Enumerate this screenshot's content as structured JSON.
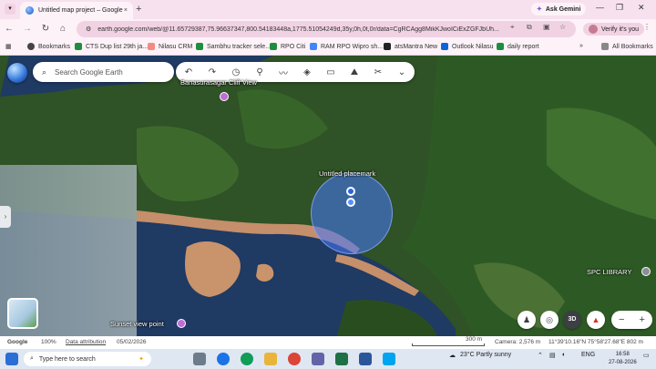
{
  "browser": {
    "tab_title": "Untitled map project – Google",
    "tab_close": "×",
    "new_tab": "+",
    "ask_gemini": "Ask Gemini",
    "url": "earth.google.com/web/@11.65729387,75.96637347,800.54183448a,1775.51054249d,35y,0h,0t,0r/data=CgRCAgg8MikKJwoICiExZGFJbUh...",
    "verify_label": "Verify it's you",
    "window_controls": [
      "—",
      "❐",
      "✕"
    ]
  },
  "bookmarks": {
    "items": [
      {
        "label": "Bookmarks",
        "color": "#444444"
      },
      {
        "label": "CTS Dup list 29th ja...",
        "color": "#1e8e3e"
      },
      {
        "label": "Nilasu CRM",
        "color": "#f28b82"
      },
      {
        "label": "Sambhu tracker sele...",
        "color": "#1e8e3e"
      },
      {
        "label": "RPO Citi",
        "color": "#1e8e3e"
      },
      {
        "label": "RAM RPO Wipro sh...",
        "color": "#4285f4"
      },
      {
        "label": "atsMantra New",
        "color": "#202124"
      },
      {
        "label": "Outlook Nilasu",
        "color": "#0a64d8"
      },
      {
        "label": "daily report",
        "color": "#1e8e3e"
      }
    ],
    "more": "»",
    "all_bookmarks": "All Bookmarks"
  },
  "earth": {
    "search_placeholder": "Search Google Earth",
    "toolbar_icons": [
      "undo-icon",
      "redo-icon",
      "history-icon",
      "pin-icon",
      "path-icon",
      "layers-icon",
      "measure-icon",
      "photo-icon",
      "tools-icon",
      "chevron-down-icon"
    ],
    "labels": {
      "top_label": "Banasurasagar Cliff View",
      "placemark": "Untitled placemark",
      "sunset": "Sunset view point",
      "spc": "SPC LIBRARY"
    },
    "view_3d": "3D"
  },
  "status": {
    "google": "Google",
    "zoom": "100%",
    "attribution": "Data attribution",
    "date": "05/02/2026",
    "scale": "300 m",
    "camera": "Camera: 2,576 m",
    "coords": "11°39'10.16\"N 75°58'27.68\"E 802 m"
  },
  "taskbar": {
    "search_placeholder": "Type here to search",
    "weather": "23°C  Partly sunny",
    "lang": "ENG",
    "time": "16:58",
    "date": "27-08-2026"
  }
}
